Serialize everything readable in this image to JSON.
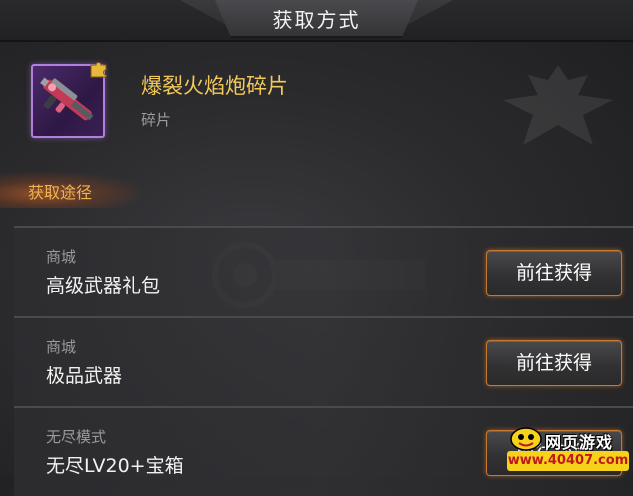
{
  "header": {
    "title": "获取方式"
  },
  "item": {
    "name": "爆裂火焰炮碎片",
    "type": "碎片",
    "icon": "flame-cannon-weapon-icon",
    "badge_icon": "puzzle-piece-icon"
  },
  "section": {
    "label": "获取途径"
  },
  "sources": [
    {
      "category": "商城",
      "name": "高级武器礼包",
      "button": "前往获得"
    },
    {
      "category": "商城",
      "name": "极品武器",
      "button": "前往获得"
    },
    {
      "category": "无尽模式",
      "name": "无尽LV20+宝箱",
      "button": "前往获得"
    }
  ],
  "watermark": {
    "title": "网页游戏",
    "url": "www.40407.com"
  },
  "colors": {
    "accent_gold": "#f3c95b",
    "section_orange": "#f0b350",
    "button_border": "#c8782e",
    "rarity_purple": "#b37fdc"
  }
}
